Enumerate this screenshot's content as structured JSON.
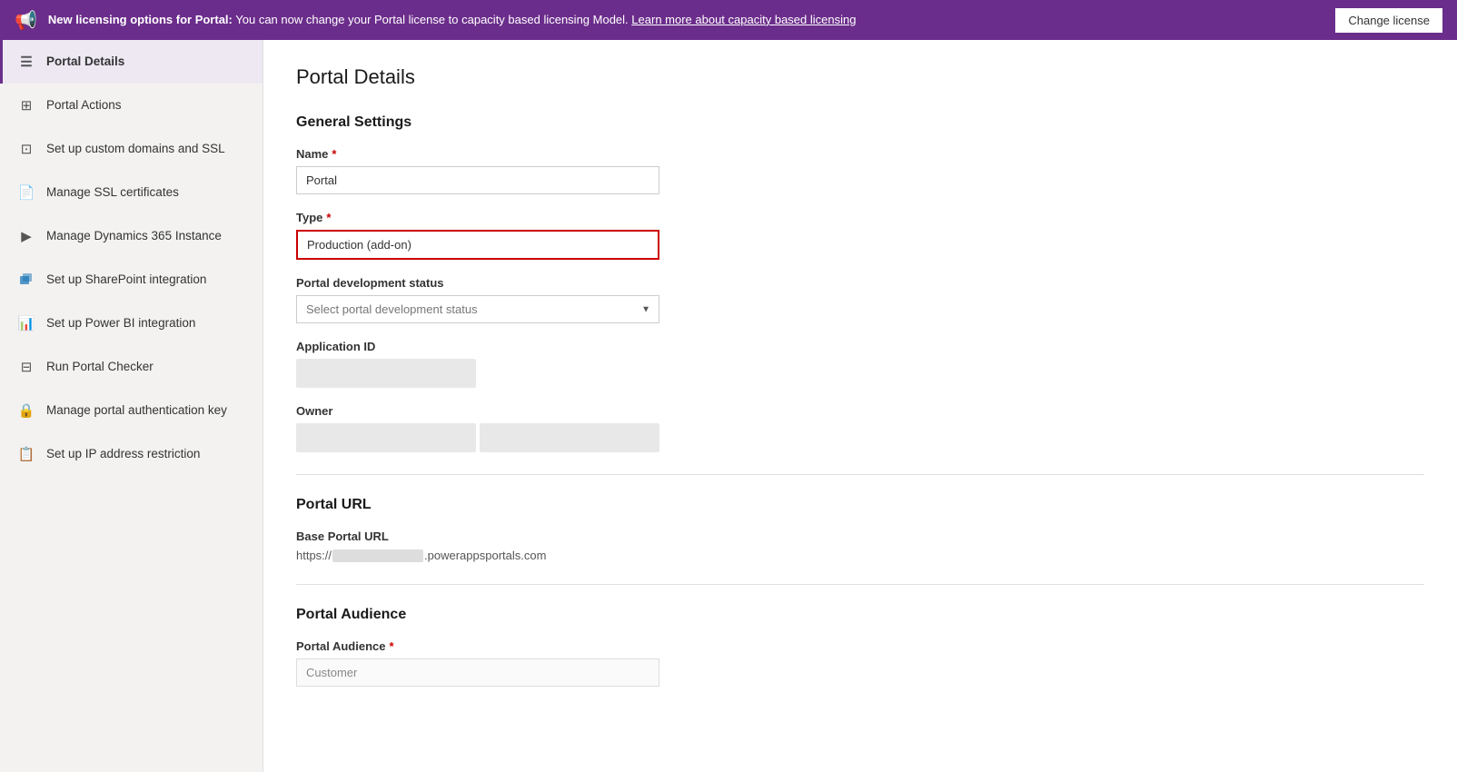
{
  "banner": {
    "icon": "📢",
    "bold_text": "New licensing options for Portal:",
    "text": " You can now change your Portal license to capacity based licensing Model.",
    "link_text": "Learn more about capacity based licensing",
    "button_label": "Change license"
  },
  "sidebar": {
    "items": [
      {
        "id": "portal-details",
        "label": "Portal Details",
        "icon": "☰",
        "active": true
      },
      {
        "id": "portal-actions",
        "label": "Portal Actions",
        "icon": "⊞"
      },
      {
        "id": "custom-domains",
        "label": "Set up custom domains and SSL",
        "icon": "⊡"
      },
      {
        "id": "ssl-certs",
        "label": "Manage SSL certificates",
        "icon": "📄"
      },
      {
        "id": "dynamics365",
        "label": "Manage Dynamics 365 Instance",
        "icon": "▶"
      },
      {
        "id": "sharepoint",
        "label": "Set up SharePoint integration",
        "icon": "🔷"
      },
      {
        "id": "powerbi",
        "label": "Set up Power BI integration",
        "icon": "📊"
      },
      {
        "id": "portal-checker",
        "label": "Run Portal Checker",
        "icon": "⊟"
      },
      {
        "id": "auth-key",
        "label": "Manage portal authentication key",
        "icon": "🔒"
      },
      {
        "id": "ip-restriction",
        "label": "Set up IP address restriction",
        "icon": "📋"
      }
    ]
  },
  "content": {
    "page_title": "Portal Details",
    "general_settings_title": "General Settings",
    "name_label": "Name",
    "name_value": "Portal",
    "name_required": "*",
    "type_label": "Type",
    "type_value": "Production (add-on)",
    "type_required": "*",
    "dev_status_label": "Portal development status",
    "dev_status_placeholder": "Select portal development status",
    "app_id_label": "Application ID",
    "owner_label": "Owner",
    "portal_url_title": "Portal URL",
    "base_url_label": "Base Portal URL",
    "base_url_prefix": "https://",
    "base_url_suffix": ".powerappsportals.com",
    "portal_audience_title": "Portal Audience",
    "portal_audience_label": "Portal Audience",
    "portal_audience_required": "*",
    "portal_audience_value": "Customer"
  }
}
